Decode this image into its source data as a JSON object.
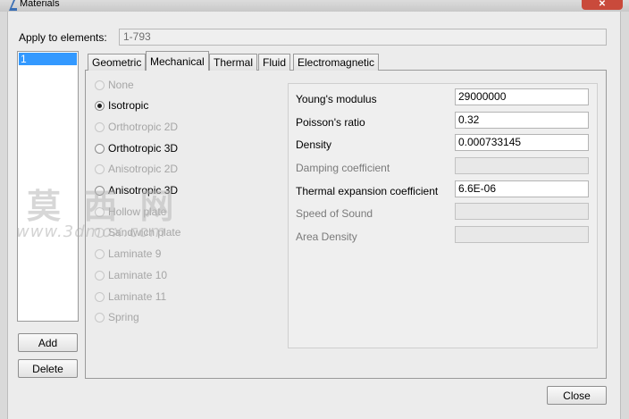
{
  "window": {
    "title": "Materials",
    "close_glyph": "✕"
  },
  "apply": {
    "label": "Apply to elements:",
    "value": "1-793"
  },
  "material_list": {
    "items": [
      "1"
    ]
  },
  "buttons": {
    "add": "Add",
    "delete": "Delete",
    "close": "Close"
  },
  "tabs": [
    {
      "label": "Geometric",
      "active": false
    },
    {
      "label": "Mechanical",
      "active": true
    },
    {
      "label": "Thermal",
      "active": false
    },
    {
      "label": "Fluid",
      "active": false
    },
    {
      "label": "Electromagnetic",
      "active": false
    }
  ],
  "material_types": [
    {
      "label": "None",
      "enabled": false,
      "selected": false
    },
    {
      "label": "Isotropic",
      "enabled": true,
      "selected": true
    },
    {
      "label": "Orthotropic 2D",
      "enabled": false,
      "selected": false
    },
    {
      "label": "Orthotropic 3D",
      "enabled": true,
      "selected": false
    },
    {
      "label": "Anisotropic 2D",
      "enabled": false,
      "selected": false
    },
    {
      "label": "Anisotropic 3D",
      "enabled": true,
      "selected": false
    },
    {
      "label": "Hollow plate",
      "enabled": false,
      "selected": false
    },
    {
      "label": "Sandwich plate",
      "enabled": false,
      "selected": false
    },
    {
      "label": "Laminate 9",
      "enabled": false,
      "selected": false
    },
    {
      "label": "Laminate 10",
      "enabled": false,
      "selected": false
    },
    {
      "label": "Laminate 11",
      "enabled": false,
      "selected": false
    },
    {
      "label": "Spring",
      "enabled": false,
      "selected": false
    }
  ],
  "properties": [
    {
      "label": "Young's modulus",
      "value": "29000000",
      "enabled": true
    },
    {
      "label": "Poisson's ratio",
      "value": "0.32",
      "enabled": true
    },
    {
      "label": "Density",
      "value": "0.000733145",
      "enabled": true
    },
    {
      "label": "Damping coefficient",
      "value": "",
      "enabled": false
    },
    {
      "label": "Thermal expansion coefficient",
      "value": "6.6E-06",
      "enabled": true
    },
    {
      "label": "Speed of Sound",
      "value": "",
      "enabled": false
    },
    {
      "label": "Area Density",
      "value": "",
      "enabled": false
    }
  ],
  "watermark": {
    "text": "莫 西 网",
    "url": "www.3dmox.com"
  },
  "colors": {
    "selection": "#3399ff",
    "close_button": "#c94a3b"
  }
}
